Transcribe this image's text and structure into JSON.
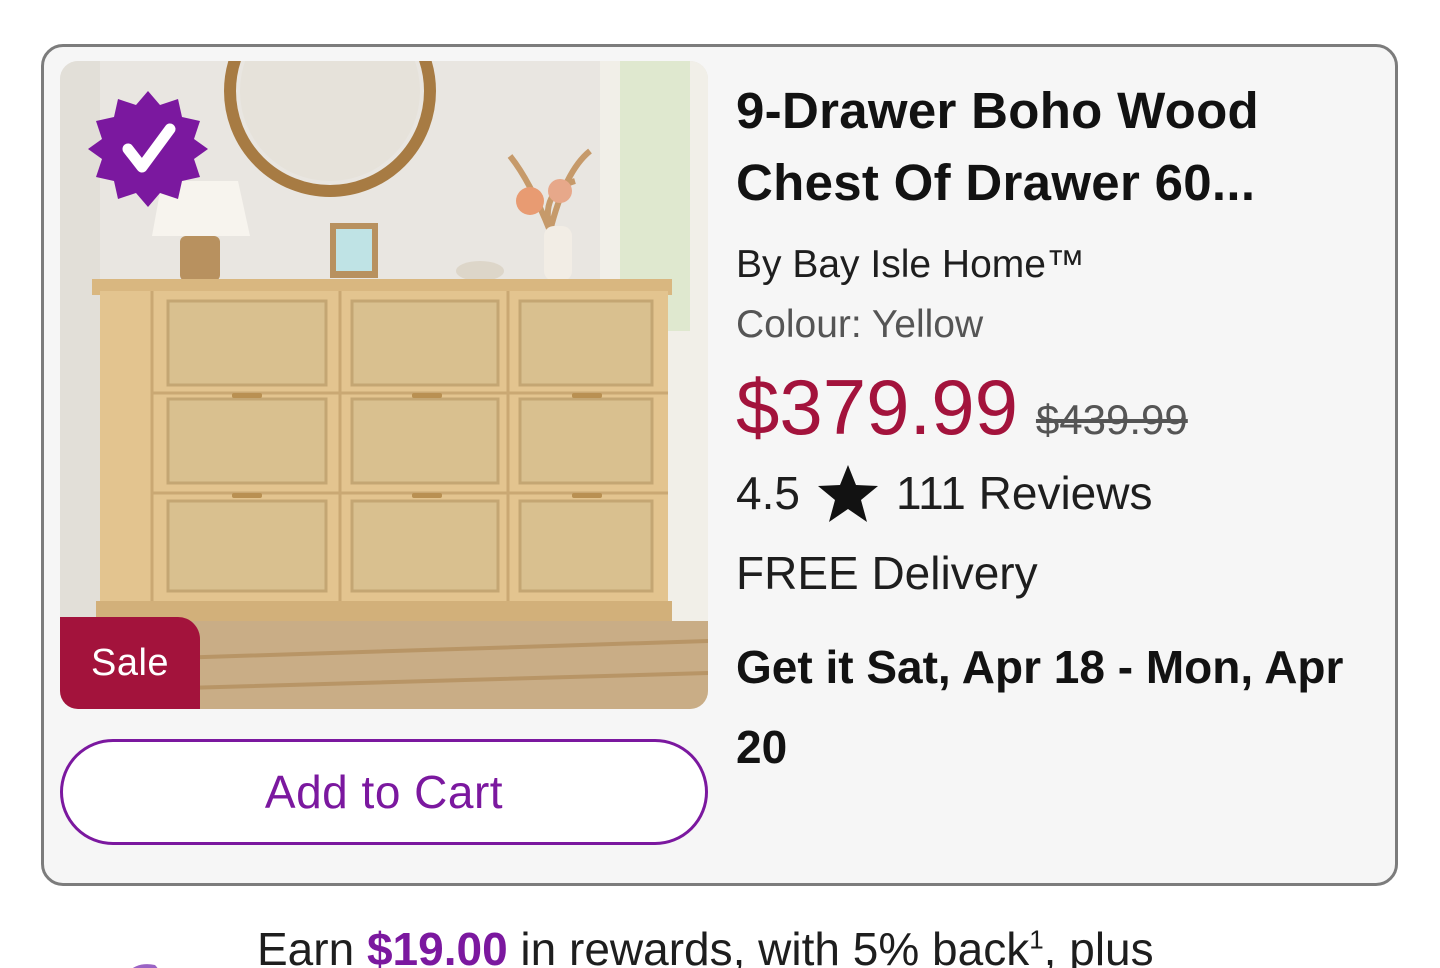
{
  "product": {
    "title": "9-Drawer Boho Wood Chest Of Drawer 60...",
    "brand": "By Bay Isle Home™",
    "colour": "Colour: Yellow",
    "sale_price": "$379.99",
    "original_price": "$439.99",
    "rating": "4.5",
    "reviews": "111 Reviews",
    "delivery": "FREE Delivery",
    "eta": "Get it Sat, Apr 18 - Mon, Apr 20",
    "sale_badge": "Sale",
    "verified_icon": "verified-check-icon",
    "star_icon": "star-icon"
  },
  "actions": {
    "add_to_cart": "Add to Cart"
  },
  "rewards": {
    "prefix": "Earn ",
    "amount": "$19.00",
    "middle": " in rewards, with 5% back",
    "footnote": "1",
    "suffix": ", plus"
  },
  "colors": {
    "accent_purple": "#7b189f",
    "sale_red": "#a3133c",
    "card_bg": "#f6f6f6"
  }
}
